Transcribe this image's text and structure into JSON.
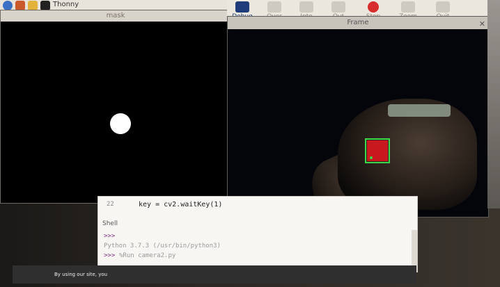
{
  "taskbar": {
    "app_label": "Thonny"
  },
  "mask_window": {
    "title": "mask"
  },
  "ide_toolbar": {
    "tools": [
      {
        "label": "Debug"
      },
      {
        "label": "Over"
      },
      {
        "label": "Into"
      },
      {
        "label": "Out"
      },
      {
        "label": "Stop"
      },
      {
        "label": "Zoom"
      },
      {
        "label": "Quit"
      }
    ]
  },
  "frame_window": {
    "title": "Frame",
    "close_glyph": "✕"
  },
  "editor": {
    "line_number": "22",
    "code": "key = cv2.waitKey(1)"
  },
  "shell": {
    "label": "Shell",
    "prompt1": ">>>",
    "interpreter": "Python 3.7.3 (/usr/bin/python3)",
    "prompt2": ">>>",
    "command": "%Run camera2.py"
  },
  "cookie_bar": {
    "text": "By using our site, you"
  },
  "colors": {
    "detection_box": "#3bd84a",
    "detected_object": "#c8191f"
  }
}
